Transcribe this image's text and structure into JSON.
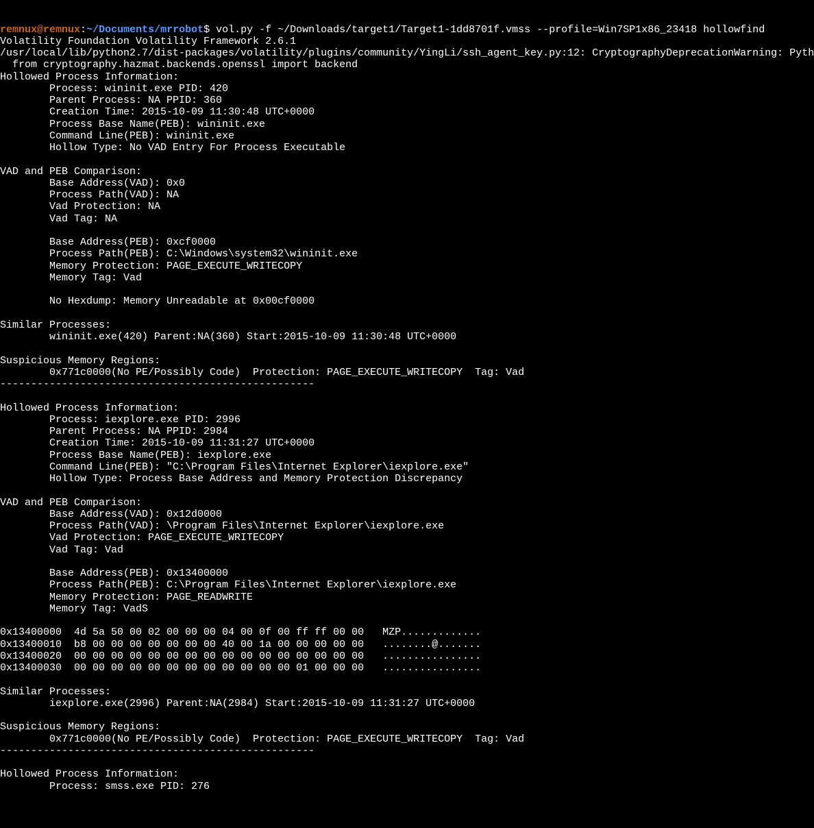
{
  "prompt": {
    "user": "remnux",
    "at": "@",
    "host": "remnux",
    "colon": ":",
    "path": "~/Documents/mrrobot",
    "dollar": "$"
  },
  "command": " vol.py -f ~/Downloads/target1/Target1-1dd8701f.vmss --profile=Win7SP1x86_23418 hollowfind",
  "lines": {
    "l01": "Volatility Foundation Volatility Framework 2.6.1",
    "l02": "/usr/local/lib/python2.7/dist-packages/volatility/plugins/community/YingLi/ssh_agent_key.py:12: CryptographyDeprecationWarning: Pyth",
    "l03": "  from cryptography.hazmat.backends.openssl import backend",
    "l04": "Hollowed Process Information:",
    "l05": "        Process: wininit.exe PID: 420",
    "l06": "        Parent Process: NA PPID: 360",
    "l07": "        Creation Time: 2015-10-09 11:30:48 UTC+0000",
    "l08": "        Process Base Name(PEB): wininit.exe",
    "l09": "        Command Line(PEB): wininit.exe",
    "l10": "        Hollow Type: No VAD Entry For Process Executable",
    "l11": "",
    "l12": "VAD and PEB Comparison:",
    "l13": "        Base Address(VAD): 0x0",
    "l14": "        Process Path(VAD): NA",
    "l15": "        Vad Protection: NA",
    "l16": "        Vad Tag: NA",
    "l17": "",
    "l18": "        Base Address(PEB): 0xcf0000",
    "l19": "        Process Path(PEB): C:\\Windows\\system32\\wininit.exe",
    "l20": "        Memory Protection: PAGE_EXECUTE_WRITECOPY",
    "l21": "        Memory Tag: Vad",
    "l22": "",
    "l23": "        No Hexdump: Memory Unreadable at 0x00cf0000",
    "l24": "",
    "l25": "Similar Processes:",
    "l26": "        wininit.exe(420) Parent:NA(360) Start:2015-10-09 11:30:48 UTC+0000",
    "l27": "",
    "l28": "Suspicious Memory Regions:",
    "l29": "        0x771c0000(No PE/Possibly Code)  Protection: PAGE_EXECUTE_WRITECOPY  Tag: Vad",
    "l30": "---------------------------------------------------",
    "l31": "",
    "l32": "Hollowed Process Information:",
    "l33": "        Process: iexplore.exe PID: 2996",
    "l34": "        Parent Process: NA PPID: 2984",
    "l35": "        Creation Time: 2015-10-09 11:31:27 UTC+0000",
    "l36": "        Process Base Name(PEB): iexplore.exe",
    "l37": "        Command Line(PEB): \"C:\\Program Files\\Internet Explorer\\iexplore.exe\"",
    "l38": "        Hollow Type: Process Base Address and Memory Protection Discrepancy",
    "l39": "",
    "l40": "VAD and PEB Comparison:",
    "l41": "        Base Address(VAD): 0x12d0000",
    "l42": "        Process Path(VAD): \\Program Files\\Internet Explorer\\iexplore.exe",
    "l43": "        Vad Protection: PAGE_EXECUTE_WRITECOPY",
    "l44": "        Vad Tag: Vad",
    "l45": "",
    "l46": "        Base Address(PEB): 0x13400000",
    "l47": "        Process Path(PEB): C:\\Program Files\\Internet Explorer\\iexplore.exe",
    "l48": "        Memory Protection: PAGE_READWRITE",
    "l49": "        Memory Tag: VadS",
    "l50": "",
    "l51": "0x13400000  4d 5a 50 00 02 00 00 00 04 00 0f 00 ff ff 00 00   MZP.............",
    "l52": "0x13400010  b8 00 00 00 00 00 00 00 40 00 1a 00 00 00 00 00   ........@.......",
    "l53": "0x13400020  00 00 00 00 00 00 00 00 00 00 00 00 00 00 00 00   ................",
    "l54": "0x13400030  00 00 00 00 00 00 00 00 00 00 00 00 01 00 00 00   ................",
    "l55": "",
    "l56": "Similar Processes:",
    "l57": "        iexplore.exe(2996) Parent:NA(2984) Start:2015-10-09 11:31:27 UTC+0000",
    "l58": "",
    "l59": "Suspicious Memory Regions:",
    "l60": "        0x771c0000(No PE/Possibly Code)  Protection: PAGE_EXECUTE_WRITECOPY  Tag: Vad",
    "l61": "---------------------------------------------------",
    "l62": "",
    "l63": "Hollowed Process Information:",
    "l64": "        Process: smss.exe PID: 276"
  }
}
